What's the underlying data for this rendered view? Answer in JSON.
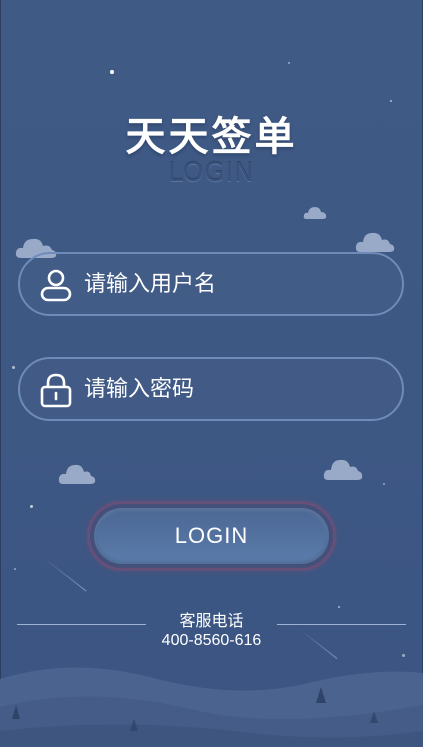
{
  "header": {
    "title": "天天签单",
    "subtitle": "LOGIN"
  },
  "form": {
    "username_placeholder": "请输入用户名",
    "password_placeholder": "请输入密码",
    "login_label": "LOGIN"
  },
  "footer": {
    "service_label": "客服电话",
    "service_phone": "400-8560-616"
  },
  "icons": {
    "username": "user-icon",
    "password": "lock-icon"
  },
  "colors": {
    "background": "#3f5a85",
    "field_border": "#6e8bb9",
    "button": "#5b7cab",
    "button_ring": "#65507a",
    "cloud": "#a9b9d3",
    "text": "#ffffff"
  }
}
